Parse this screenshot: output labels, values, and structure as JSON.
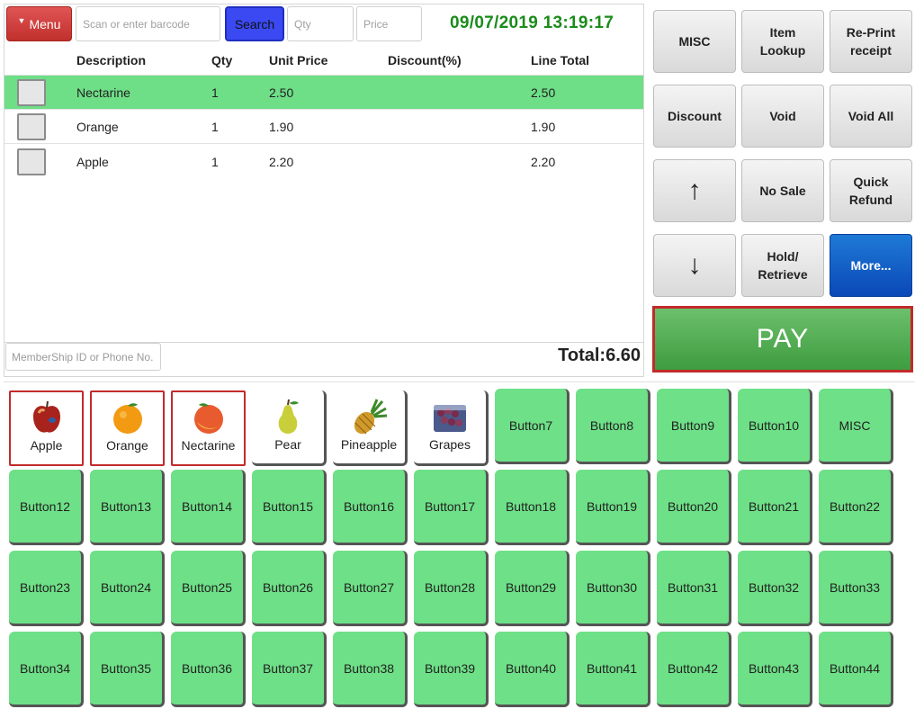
{
  "header": {
    "menu_label": "Menu",
    "barcode_placeholder": "Scan or enter barcode",
    "search_label": "Search",
    "qty_placeholder": "Qty",
    "price_placeholder": "Price",
    "datetime": "09/07/2019 13:19:17"
  },
  "grid": {
    "columns": [
      "Description",
      "Qty",
      "Unit Price",
      "Discount(%)",
      "Line Total"
    ],
    "rows": [
      {
        "description": "Nectarine",
        "qty": "1",
        "unit_price": "2.50",
        "discount": "",
        "line_total": "2.50",
        "selected": true
      },
      {
        "description": "Orange",
        "qty": "1",
        "unit_price": "1.90",
        "discount": "",
        "line_total": "1.90",
        "selected": false
      },
      {
        "description": "Apple",
        "qty": "1",
        "unit_price": "2.20",
        "discount": "",
        "line_total": "2.20",
        "selected": false
      }
    ]
  },
  "footer": {
    "member_placeholder": "MemberShip ID or Phone No.",
    "total": "Total:6.60"
  },
  "functions": {
    "misc": "MISC",
    "item_lookup": "Item\nLookup",
    "reprint": "Re-Print\nreceipt",
    "discount": "Discount",
    "void": "Void",
    "void_all": "Void All",
    "up": "↑",
    "no_sale": "No Sale",
    "quick_refund": "Quick\nRefund",
    "down": "↓",
    "hold": "Hold/\nRetrieve",
    "more": "More...",
    "pay": "PAY"
  },
  "products": {
    "fruits": [
      "Apple",
      "Orange",
      "Nectarine",
      "Pear",
      "Pineapple",
      "Grapes"
    ],
    "row1_rest": [
      "Button7",
      "Button8",
      "Button9",
      "Button10",
      "MISC"
    ],
    "row2": [
      "Button12",
      "Button13",
      "Button14",
      "Button15",
      "Button16",
      "Button17",
      "Button18",
      "Button19",
      "Button20",
      "Button21",
      "Button22"
    ],
    "row3": [
      "Button23",
      "Button24",
      "Button25",
      "Button26",
      "Button27",
      "Button28",
      "Button29",
      "Button30",
      "Button31",
      "Button32",
      "Button33"
    ],
    "row4": [
      "Button34",
      "Button35",
      "Button36",
      "Button37",
      "Button38",
      "Button39",
      "Button40",
      "Button41",
      "Button42",
      "Button43",
      "Button44"
    ]
  },
  "colors": {
    "selected_row": "#6ede87",
    "product_button": "#6ee087",
    "datetime": "#1a8c1a",
    "pay": "#4caf50",
    "more": "#0a48b8"
  }
}
